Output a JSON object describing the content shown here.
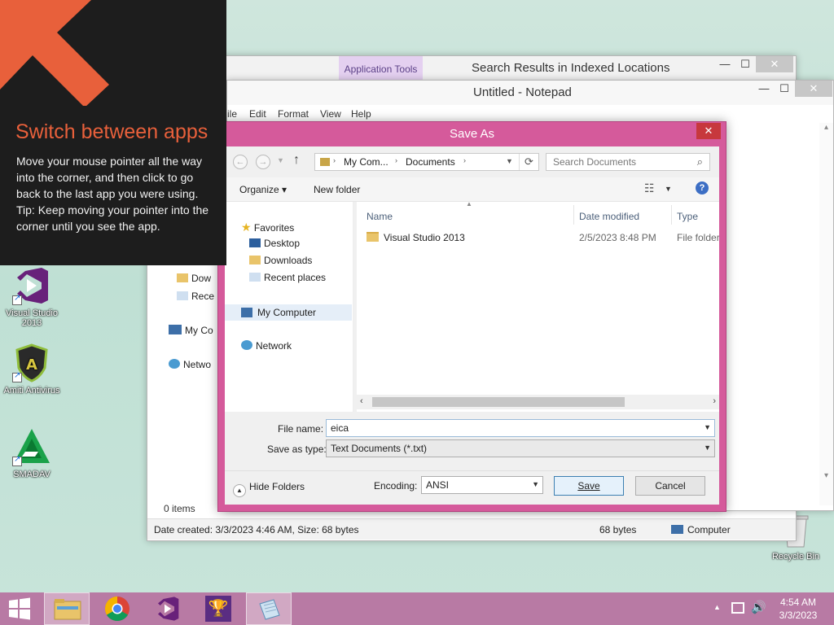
{
  "charm": {
    "heading": "Switch between apps",
    "body": "Move your mouse pointer all the way into the corner, and then click to go back to the last app you were using.",
    "tip": "Tip: Keep moving your pointer into the corner until you see the app."
  },
  "desktop": {
    "icons": [
      {
        "label": "Visual Studio 2013",
        "icon": "visual-studio-icon"
      },
      {
        "label": "Amiti Antivirus",
        "icon": "antivirus-shield-icon"
      },
      {
        "label": "SMADAV",
        "icon": "smadav-icon"
      },
      {
        "label": "Recycle Bin",
        "icon": "recycle-bin-icon"
      }
    ]
  },
  "explorer": {
    "ribbon_tab": "Application Tools",
    "title": "Search Results in Indexed Locations",
    "nav_items": [
      "Dow",
      "Rece",
      "My Co",
      "Netwo"
    ],
    "items_count": "0 items",
    "status_text": "Date created: 3/3/2023 4:46 AM, Size: 68 bytes",
    "status_size": "68 bytes",
    "status_location": "Computer"
  },
  "notepad": {
    "title": "Untitled - Notepad",
    "menu": [
      "ile",
      "Edit",
      "Format",
      "View",
      "Help"
    ]
  },
  "saveas": {
    "title": "Save As",
    "close": "✕",
    "breadcrumb": [
      "My Com...",
      "Documents"
    ],
    "search_placeholder": "Search Documents",
    "organize": "Organize",
    "new_folder": "New folder",
    "nav": {
      "favorites": "Favorites",
      "desktop": "Desktop",
      "downloads": "Downloads",
      "recent": "Recent places",
      "computer": "My Computer",
      "network": "Network"
    },
    "columns": {
      "name": "Name",
      "date": "Date modified",
      "type": "Type"
    },
    "files": [
      {
        "name": "Visual Studio 2013",
        "date": "2/5/2023 8:48 PM",
        "type": "File folder"
      }
    ],
    "file_name_label": "File name:",
    "file_name_value": "eica",
    "save_type_label": "Save as type:",
    "save_type_value": "Text Documents (*.txt)",
    "hide_folders": "Hide Folders",
    "encoding_label": "Encoding:",
    "encoding_value": "ANSI",
    "save_button": "Save",
    "cancel_button": "Cancel"
  },
  "taskbar": {
    "apps": [
      "file-explorer-icon",
      "chrome-icon",
      "visual-studio-icon",
      "trophy-icon",
      "notepad-icon"
    ],
    "time": "4:54 AM",
    "date": "3/3/2023"
  },
  "colors": {
    "dialog_frame": "#d55a9b",
    "taskbar": "#b87aa4",
    "charm_accent": "#e8603b",
    "desktop": "#c6e3d8"
  }
}
